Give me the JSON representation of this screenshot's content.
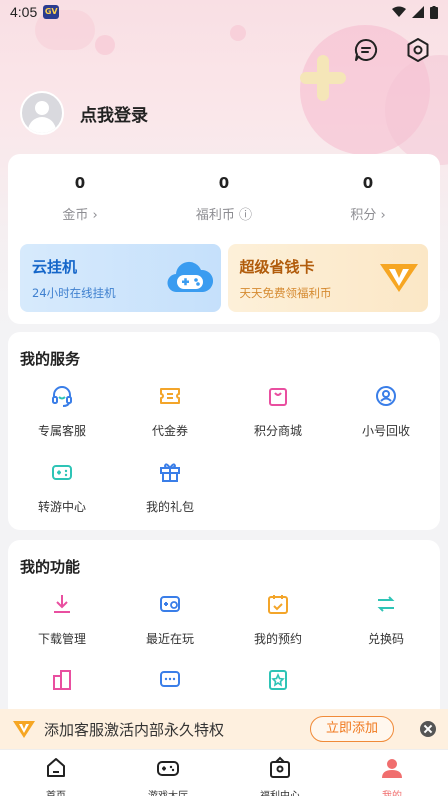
{
  "status_bar": {
    "time": "4:05",
    "app_badge": "GV"
  },
  "profile": {
    "login_text": "点我登录"
  },
  "stats": [
    {
      "value": "0",
      "label": "金币 ›"
    },
    {
      "value": "0",
      "label": "福利币 ⓘ"
    },
    {
      "value": "0",
      "label": "积分 ›"
    }
  ],
  "promos": {
    "cloud": {
      "title": "云挂机",
      "subtitle": "24小时在线挂机"
    },
    "card": {
      "title": "超级省钱卡",
      "subtitle": "天天免费领福利币"
    }
  },
  "services": {
    "title": "我的服务",
    "items": [
      {
        "label": "专属客服",
        "icon": "headset-icon"
      },
      {
        "label": "代金券",
        "icon": "voucher-icon"
      },
      {
        "label": "积分商城",
        "icon": "shopping-bag-icon"
      },
      {
        "label": "小号回收",
        "icon": "account-recycle-icon"
      },
      {
        "label": "转游中心",
        "icon": "game-transfer-icon"
      },
      {
        "label": "我的礼包",
        "icon": "gift-icon"
      }
    ]
  },
  "features": {
    "title": "我的功能",
    "items": [
      {
        "label": "下载管理",
        "icon": "download-icon"
      },
      {
        "label": "最近在玩",
        "icon": "recent-play-icon"
      },
      {
        "label": "我的预约",
        "icon": "calendar-icon"
      },
      {
        "label": "兑换码",
        "icon": "exchange-icon"
      }
    ]
  },
  "banner": {
    "text": "添加客服激活内部永久特权",
    "button": "立即添加"
  },
  "tabs": [
    {
      "label": "首页",
      "icon": "home-icon"
    },
    {
      "label": "游戏大厅",
      "icon": "gamepad-icon"
    },
    {
      "label": "福利中心",
      "icon": "welfare-icon"
    },
    {
      "label": "我的",
      "icon": "user-icon",
      "active": true
    }
  ],
  "colors": {
    "accent": "#f06e6e",
    "orange": "#f07a20",
    "blue": "#1566c9"
  }
}
